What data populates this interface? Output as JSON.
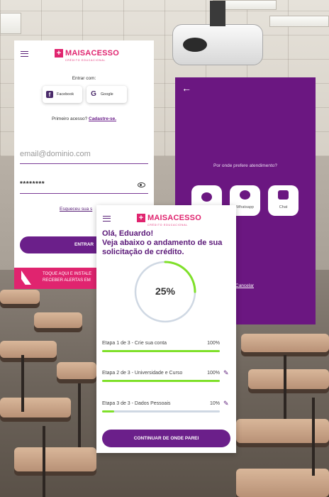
{
  "brand": {
    "logo_text": "MAISACESSO",
    "logo_subtext": "CRÉDITO EDUCACIONAL",
    "accent": "#e0246f",
    "primary": "#6b1f8a"
  },
  "login": {
    "prompt": "Entrar com:",
    "facebook_label": "Facebook",
    "google_label": "Google",
    "first_access": "Primeiro acesso?",
    "signup_link": "Cadastre-se.",
    "email_placeholder": "email@dominio.com",
    "password_value": "********",
    "forgot_link": "Esqueceu sua s",
    "enter_button": "ENTRAR",
    "banner_line1": "TOQUE AQUI E INSTALE",
    "banner_line2": "RECEBER ALERTAS EM"
  },
  "support": {
    "question": "Por onde prefere atendimento?",
    "options": [
      {
        "label": "",
        "icon": "messenger-icon"
      },
      {
        "label": "Whatsapp",
        "icon": "whatsapp-icon"
      },
      {
        "label": "Chat",
        "icon": "chat-icon"
      }
    ],
    "cancel_link": "Cancelar"
  },
  "progress": {
    "greeting": "Olá, Eduardo!",
    "subtitle": "Veja abaixo o andamento de sua solicitação de crédito.",
    "overall_label": "25%",
    "overall_value": 0.25,
    "steps": [
      {
        "name": "Etapa 1 de 3 - Crie sua conta",
        "pct": "100%",
        "value": 1.0
      },
      {
        "name": "Etapa 2 de 3 - Universidade e Curso",
        "pct": "100%",
        "value": 1.0
      },
      {
        "name": "Etapa 3 de 3 - Dados Pessoais",
        "pct": "10%",
        "value": 0.1
      }
    ],
    "continue_button": "CONTINUAR DE ONDE PAREI"
  }
}
